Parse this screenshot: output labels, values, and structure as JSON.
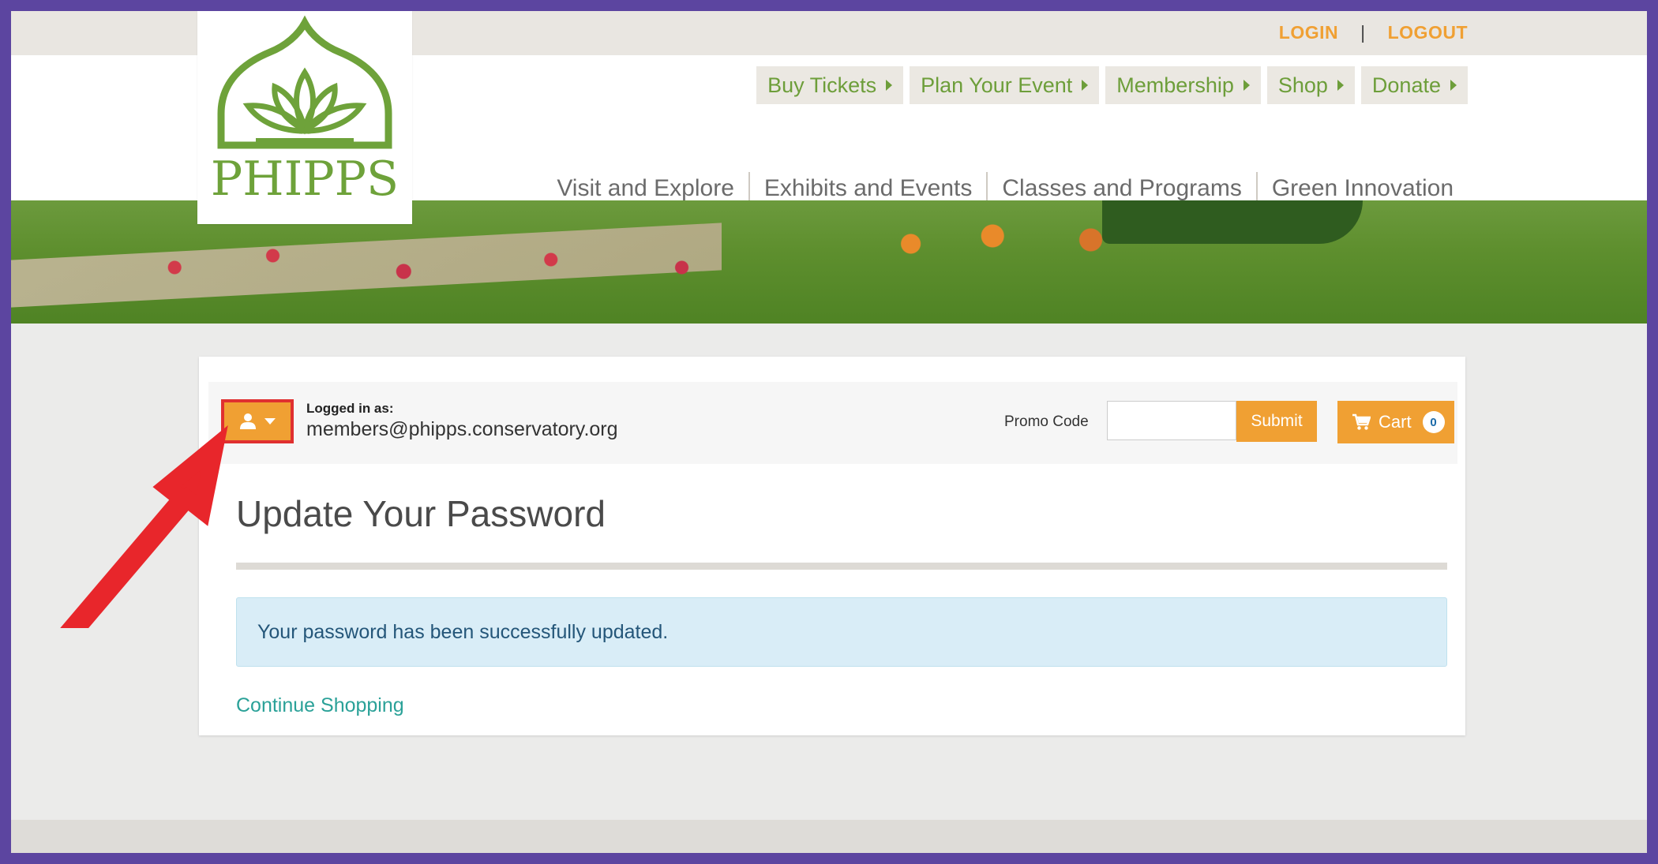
{
  "utility": {
    "login": "LOGIN",
    "separator": "|",
    "logout": "LOGOUT"
  },
  "logo": {
    "text": "PHIPPS"
  },
  "primary_nav": [
    {
      "label": "Buy Tickets"
    },
    {
      "label": "Plan Your Event"
    },
    {
      "label": "Membership"
    },
    {
      "label": "Shop"
    },
    {
      "label": "Donate"
    }
  ],
  "secondary_nav": [
    {
      "label": "Visit and Explore"
    },
    {
      "label": "Exhibits and Events"
    },
    {
      "label": "Classes and Programs"
    },
    {
      "label": "Green Innovation"
    }
  ],
  "account": {
    "logged_in_label": "Logged in as:",
    "email": "members@phipps.conservatory.org",
    "promo_label": "Promo Code",
    "promo_value": "",
    "submit_label": "Submit",
    "cart_label": "Cart",
    "cart_count": "0"
  },
  "main": {
    "title": "Update Your Password",
    "alert": "Your password has been successfully updated.",
    "continue_link": "Continue Shopping"
  },
  "colors": {
    "frame_border": "#5c45a0",
    "accent_orange": "#f0a033",
    "brand_green": "#6d9e3a",
    "annotation_red": "#e03030",
    "alert_bg": "#d9edf7",
    "link_teal": "#2aa198"
  }
}
